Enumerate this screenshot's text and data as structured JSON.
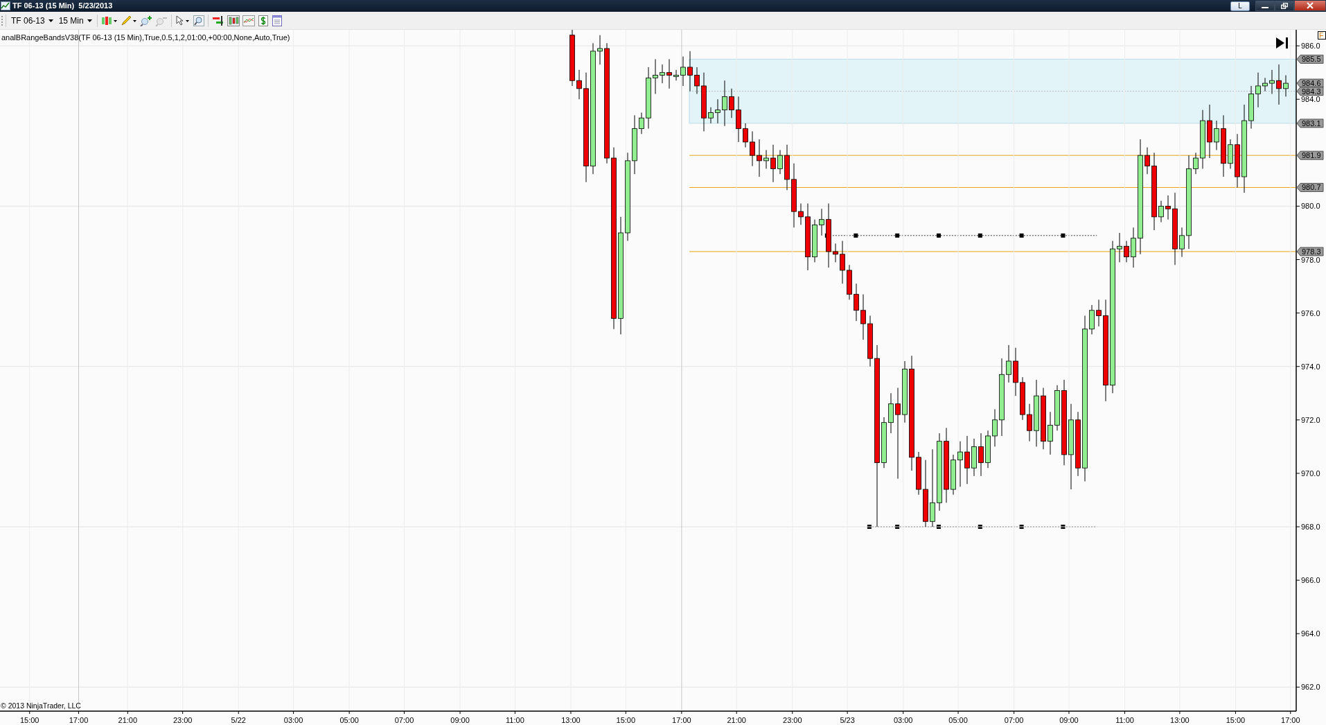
{
  "window": {
    "title": "TF 06-13 (15 Min)  5/23/2013",
    "side_button": "L"
  },
  "toolbar": {
    "instrument": "TF 06-13",
    "interval": "15 Min"
  },
  "chart": {
    "indicator_label": "analBRangeBandsV38(TF 06-13 (15 Min),True,0.5,1,2,01:00,+00:00,None,Auto,True)",
    "corner_label": "F",
    "copyright": "© 2013 NinjaTrader, LLC",
    "time_axis": {
      "labels": [
        "15:00",
        "17:00",
        "21:00",
        "23:00",
        "5/22",
        "03:00",
        "05:00",
        "07:00",
        "09:00",
        "11:00",
        "13:00",
        "15:00",
        "17:00",
        "21:00",
        "23:00",
        "5/23",
        "03:00",
        "05:00",
        "07:00",
        "09:00",
        "11:00",
        "13:00",
        "15:00",
        "17:00"
      ]
    },
    "chart_data": {
      "type": "candlestick",
      "ylim": [
        961.1,
        986.6
      ],
      "grid": true,
      "yticks": [
        {
          "value": 986,
          "label": "986.0"
        },
        {
          "value": 984,
          "label": "984.0"
        },
        {
          "value": 980,
          "label": "980.0"
        },
        {
          "value": 978,
          "label": "978.0"
        },
        {
          "value": 976,
          "label": "976.0"
        },
        {
          "value": 974,
          "label": "974.0"
        },
        {
          "value": 972,
          "label": "972.0"
        },
        {
          "value": 970,
          "label": "970.0"
        },
        {
          "value": 968,
          "label": "968.0"
        },
        {
          "value": 966,
          "label": "966.0"
        },
        {
          "value": 964,
          "label": "964.0"
        },
        {
          "value": 962,
          "label": "962.0"
        }
      ],
      "annotations": [
        "985.5",
        "984.6",
        "984.3",
        "983.1",
        "981.9",
        "980.7",
        "978.3"
      ],
      "ohlc": [
        [
          986.4,
          986.6,
          984.5,
          984.7
        ],
        [
          984.7,
          985.1,
          984.0,
          984.4
        ],
        [
          984.4,
          985.0,
          980.9,
          981.5
        ],
        [
          981.5,
          986.1,
          981.2,
          985.8
        ],
        [
          985.8,
          986.4,
          985.3,
          985.9
        ],
        [
          985.9,
          986.1,
          981.6,
          981.8
        ],
        [
          981.8,
          982.2,
          975.4,
          975.8
        ],
        [
          975.8,
          979.6,
          975.2,
          979.0
        ],
        [
          979.0,
          982.0,
          978.7,
          981.7
        ],
        [
          981.7,
          983.4,
          981.2,
          982.9
        ],
        [
          982.9,
          983.5,
          982.7,
          983.3
        ],
        [
          983.3,
          985.2,
          982.9,
          984.8
        ],
        [
          984.8,
          985.5,
          984.2,
          984.9
        ],
        [
          984.9,
          985.3,
          984.6,
          985.0
        ],
        [
          985.0,
          985.5,
          984.4,
          984.9
        ],
        [
          984.9,
          985.1,
          984.7,
          984.9
        ],
        [
          984.9,
          985.6,
          984.5,
          985.2
        ],
        [
          985.2,
          985.8,
          984.3,
          984.9
        ],
        [
          984.9,
          985.2,
          984.2,
          984.5
        ],
        [
          984.5,
          985.0,
          982.8,
          983.3
        ],
        [
          983.3,
          983.7,
          983.1,
          983.5
        ],
        [
          983.5,
          984.0,
          983.1,
          983.6
        ],
        [
          983.6,
          984.7,
          983.0,
          984.1
        ],
        [
          984.1,
          984.4,
          983.3,
          983.6
        ],
        [
          983.6,
          984.1,
          982.4,
          982.9
        ],
        [
          982.9,
          983.1,
          982.2,
          982.4
        ],
        [
          982.4,
          982.8,
          981.5,
          981.9
        ],
        [
          981.9,
          982.5,
          981.1,
          981.7
        ],
        [
          981.7,
          982.1,
          981.4,
          981.8
        ],
        [
          981.8,
          982.3,
          980.9,
          981.4
        ],
        [
          981.4,
          982.1,
          981.2,
          981.9
        ],
        [
          981.9,
          982.3,
          980.6,
          981.0
        ],
        [
          981.0,
          981.6,
          979.2,
          979.8
        ],
        [
          979.8,
          980.1,
          979.3,
          979.6
        ],
        [
          979.6,
          980.1,
          977.6,
          978.1
        ],
        [
          978.1,
          979.5,
          977.9,
          979.3
        ],
        [
          979.3,
          979.9,
          978.9,
          979.5
        ],
        [
          979.5,
          980.1,
          977.7,
          978.3
        ],
        [
          978.3,
          978.6,
          977.9,
          978.2
        ],
        [
          978.2,
          978.7,
          977.1,
          977.6
        ],
        [
          977.6,
          977.8,
          976.5,
          976.7
        ],
        [
          976.7,
          977.1,
          975.7,
          976.1
        ],
        [
          976.1,
          976.7,
          975.0,
          975.6
        ],
        [
          975.6,
          975.9,
          974.0,
          974.3
        ],
        [
          974.3,
          974.8,
          968.0,
          970.4
        ],
        [
          970.4,
          972.1,
          970.2,
          971.9
        ],
        [
          971.9,
          973.0,
          971.5,
          972.6
        ],
        [
          972.6,
          973.2,
          969.8,
          972.2
        ],
        [
          972.2,
          974.2,
          971.9,
          973.9
        ],
        [
          973.9,
          974.4,
          970.1,
          970.6
        ],
        [
          970.6,
          970.8,
          969.2,
          969.4
        ],
        [
          969.4,
          970.5,
          968.0,
          968.2
        ],
        [
          968.2,
          970.9,
          968.0,
          968.9
        ],
        [
          968.9,
          971.5,
          968.6,
          971.2
        ],
        [
          971.2,
          971.7,
          968.9,
          969.4
        ],
        [
          969.4,
          970.7,
          969.2,
          970.5
        ],
        [
          970.5,
          971.2,
          969.5,
          970.8
        ],
        [
          970.8,
          971.4,
          969.6,
          970.2
        ],
        [
          970.2,
          971.3,
          969.9,
          971.0
        ],
        [
          971.0,
          971.5,
          969.9,
          970.4
        ],
        [
          970.4,
          971.6,
          970.2,
          971.4
        ],
        [
          971.4,
          972.4,
          971.0,
          972.0
        ],
        [
          972.0,
          974.3,
          971.4,
          973.7
        ],
        [
          973.7,
          974.8,
          973.4,
          974.2
        ],
        [
          974.2,
          974.7,
          972.9,
          973.4
        ],
        [
          973.4,
          973.6,
          972.0,
          972.2
        ],
        [
          972.2,
          972.6,
          971.2,
          971.6
        ],
        [
          971.6,
          973.5,
          971.0,
          972.9
        ],
        [
          972.9,
          973.2,
          970.9,
          971.2
        ],
        [
          971.2,
          972.3,
          970.7,
          971.8
        ],
        [
          971.8,
          973.3,
          971.6,
          973.1
        ],
        [
          973.1,
          973.5,
          970.3,
          970.7
        ],
        [
          970.7,
          972.6,
          969.4,
          972.0
        ],
        [
          972.0,
          972.3,
          969.9,
          970.2
        ],
        [
          970.2,
          975.9,
          969.7,
          975.4
        ],
        [
          975.4,
          976.3,
          975.2,
          976.1
        ],
        [
          976.1,
          976.5,
          975.5,
          975.9
        ],
        [
          975.9,
          976.5,
          972.7,
          973.3
        ],
        [
          973.3,
          978.7,
          973.0,
          978.4
        ],
        [
          978.4,
          979.0,
          977.9,
          978.5
        ],
        [
          978.5,
          978.7,
          977.9,
          978.1
        ],
        [
          978.1,
          979.2,
          977.7,
          978.8
        ],
        [
          978.8,
          982.5,
          978.2,
          981.9
        ],
        [
          981.9,
          982.2,
          981.2,
          981.5
        ],
        [
          981.5,
          982.0,
          979.1,
          979.6
        ],
        [
          979.6,
          980.2,
          979.4,
          980.0
        ],
        [
          980.0,
          980.4,
          979.5,
          979.9
        ],
        [
          979.9,
          980.5,
          977.8,
          978.4
        ],
        [
          978.4,
          979.2,
          978.1,
          978.9
        ],
        [
          978.9,
          981.9,
          978.4,
          981.4
        ],
        [
          981.4,
          982.0,
          981.2,
          981.8
        ],
        [
          981.8,
          983.6,
          981.4,
          983.2
        ],
        [
          983.2,
          983.8,
          981.8,
          982.4
        ],
        [
          982.4,
          983.2,
          982.1,
          982.9
        ],
        [
          982.9,
          983.4,
          981.1,
          981.6
        ],
        [
          981.6,
          982.5,
          981.4,
          982.3
        ],
        [
          982.3,
          982.7,
          980.7,
          981.1
        ],
        [
          981.1,
          983.8,
          980.5,
          983.2
        ],
        [
          983.2,
          984.5,
          982.9,
          984.2
        ],
        [
          984.2,
          985.0,
          983.7,
          984.5
        ],
        [
          984.5,
          984.8,
          984.3,
          984.6
        ],
        [
          984.6,
          985.1,
          984.2,
          984.7
        ],
        [
          984.7,
          985.3,
          983.8,
          984.4
        ],
        [
          984.4,
          984.9,
          984.1,
          984.6
        ]
      ]
    }
  }
}
